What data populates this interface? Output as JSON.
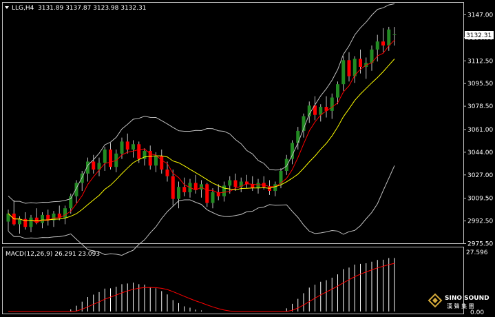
{
  "header": {
    "symbol": "LLG,H4",
    "ohlc": "3131.89 3137.87 3123.98 3132.31"
  },
  "price_badge": "3132.31",
  "macd_header": "MACD(12,26,9) 26.291 23.093",
  "logo": {
    "line1": "SINO SOUND",
    "line2": "漢 聲 集 團"
  },
  "colors": {
    "background": "#000000",
    "up_candle": "#228b22",
    "down_candle": "#ff0000",
    "fast_ma": "#ff0000",
    "slow_ma": "#ffff00",
    "bands": "#c0c0c0",
    "macd_hist": "#ffffff",
    "macd_signal": "#ff0000"
  },
  "chart_data": [
    {
      "type": "candlestick",
      "title": "LLG,H4",
      "y_ticks": [
        "3147.00",
        "3130.00",
        "3112.50",
        "3095.50",
        "3078.50",
        "3061.00",
        "3044.00",
        "3027.00",
        "3009.50",
        "2992.50",
        "2975.50"
      ],
      "ylim": [
        2975.5,
        3153.0
      ],
      "candles": [
        [
          2992,
          3001,
          2985,
          2998
        ],
        [
          2998,
          3008,
          2989,
          2990
        ],
        [
          2990,
          2996,
          2983,
          2994
        ],
        [
          2994,
          2999,
          2986,
          2988
        ],
        [
          2988,
          2997,
          2984,
          2995
        ],
        [
          2995,
          3002,
          2990,
          2991
        ],
        [
          2991,
          2999,
          2987,
          2997
        ],
        [
          2997,
          3001,
          2989,
          2993
        ],
        [
          2993,
          3000,
          2988,
          2998
        ],
        [
          2998,
          3004,
          2993,
          2995
        ],
        [
          2995,
          3004,
          2990,
          3002
        ],
        [
          3002,
          3013,
          2998,
          3011
        ],
        [
          3011,
          3023,
          3006,
          3021
        ],
        [
          3021,
          3030,
          3015,
          3028
        ],
        [
          3028,
          3040,
          3022,
          3037
        ],
        [
          3037,
          3042,
          3028,
          3031
        ],
        [
          3031,
          3040,
          3026,
          3036
        ],
        [
          3036,
          3048,
          3030,
          3046
        ],
        [
          3046,
          3051,
          3031,
          3033
        ],
        [
          3033,
          3046,
          3029,
          3043
        ],
        [
          3043,
          3055,
          3039,
          3052
        ],
        [
          3052,
          3058,
          3043,
          3046
        ],
        [
          3046,
          3053,
          3040,
          3050
        ],
        [
          3050,
          3052,
          3036,
          3039
        ],
        [
          3039,
          3047,
          3034,
          3045
        ],
        [
          3045,
          3049,
          3031,
          3034
        ],
        [
          3034,
          3044,
          3029,
          3041
        ],
        [
          3041,
          3046,
          3028,
          3031
        ],
        [
          3031,
          3037,
          3022,
          3026
        ],
        [
          3026,
          3031,
          3004,
          3009
        ],
        [
          3009,
          3022,
          3002,
          3018
        ],
        [
          3018,
          3025,
          3011,
          3014
        ],
        [
          3014,
          3024,
          3010,
          3021
        ],
        [
          3021,
          3027,
          3013,
          3016
        ],
        [
          3016,
          3023,
          3010,
          3020
        ],
        [
          3020,
          3021,
          3003,
          3006
        ],
        [
          3006,
          3017,
          3002,
          3014
        ],
        [
          3014,
          3020,
          3008,
          3011
        ],
        [
          3011,
          3022,
          3007,
          3019
        ],
        [
          3019,
          3026,
          3013,
          3023
        ],
        [
          3023,
          3028,
          3015,
          3018
        ],
        [
          3018,
          3025,
          3014,
          3022
        ],
        [
          3022,
          3027,
          3017,
          3020
        ],
        [
          3020,
          3026,
          3015,
          3017
        ],
        [
          3017,
          3024,
          3013,
          3021
        ],
        [
          3021,
          3026,
          3016,
          3018
        ],
        [
          3018,
          3023,
          3012,
          3015
        ],
        [
          3015,
          3022,
          3011,
          3020
        ],
        [
          3020,
          3032,
          3017,
          3030
        ],
        [
          3030,
          3042,
          3027,
          3039
        ],
        [
          3039,
          3053,
          3035,
          3051
        ],
        [
          3051,
          3063,
          3046,
          3060
        ],
        [
          3060,
          3073,
          3055,
          3071
        ],
        [
          3071,
          3082,
          3066,
          3079
        ],
        [
          3079,
          3086,
          3068,
          3072
        ],
        [
          3072,
          3080,
          3067,
          3078
        ],
        [
          3078,
          3086,
          3070,
          3075
        ],
        [
          3075,
          3088,
          3069,
          3085
        ],
        [
          3085,
          3097,
          3080,
          3095
        ],
        [
          3095,
          3116,
          3090,
          3113
        ],
        [
          3113,
          3119,
          3097,
          3101
        ],
        [
          3101,
          3116,
          3096,
          3114
        ],
        [
          3114,
          3121,
          3103,
          3108
        ],
        [
          3108,
          3115,
          3099,
          3111
        ],
        [
          3111,
          3124,
          3105,
          3121
        ],
        [
          3121,
          3132,
          3112,
          3127
        ],
        [
          3127,
          3137,
          3119,
          3124
        ],
        [
          3124,
          3138,
          3120,
          3136
        ],
        [
          3131.89,
          3137.87,
          3123.98,
          3132.31
        ]
      ]
    },
    {
      "type": "bar",
      "title": "MACD(12,26,9) 26.291 23.093",
      "y_ticks": [
        "27.596",
        "0.00"
      ],
      "ylim": [
        -8,
        27.596
      ]
    }
  ]
}
